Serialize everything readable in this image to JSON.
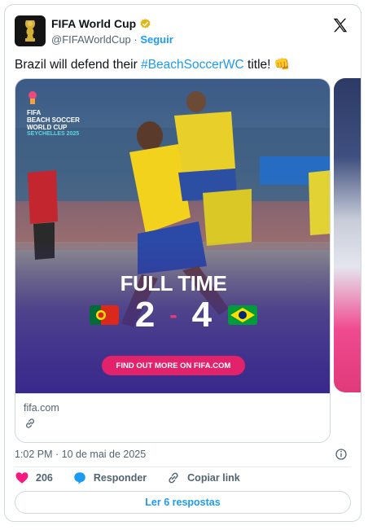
{
  "account": {
    "name": "FIFA World Cup",
    "handle": "@FIFAWorldCup",
    "separator": "·",
    "follow_label": "Seguir"
  },
  "tweet": {
    "text_before": "Brazil will defend their ",
    "hashtag": "#BeachSoccerWC",
    "text_after": " title! ",
    "emoji": "👊"
  },
  "media": {
    "logo_line1": "FIFA",
    "logo_line2": "BEACH SOCCER",
    "logo_line3": "WORLD CUP",
    "logo_line4": "SEYCHELLES 2025",
    "status": "FULL TIME",
    "home_score": "2",
    "score_separator": "-",
    "away_score": "4",
    "cta_label": "FIND OUT MORE ON FIFA.COM",
    "link_domain": "fifa.com"
  },
  "meta": {
    "timestamp": "1:02 PM · 10 de mai de 2025"
  },
  "actions": {
    "likes": "206",
    "reply_label": "Responder",
    "copy_label": "Copiar link"
  },
  "replies_button": "Ler 6 respostas",
  "colors": {
    "accent": "#1d9bf0",
    "like": "#f91880",
    "brand_pink": "#e2226b"
  },
  "icons": {
    "x": "x-logo-icon",
    "verified": "verified-badge-icon",
    "heart": "heart-icon",
    "reply": "reply-bubble-icon",
    "link": "link-icon",
    "info": "info-icon"
  }
}
